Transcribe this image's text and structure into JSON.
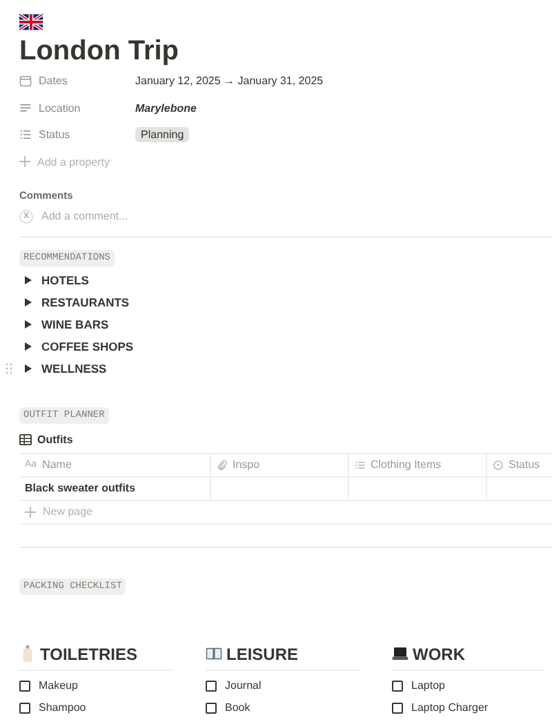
{
  "page": {
    "title": "London Trip"
  },
  "properties": [
    {
      "kind": "date",
      "label": "Dates",
      "value": "January 12, 2025 → January 31, 2025"
    },
    {
      "kind": "text",
      "label": "Location",
      "value": "Marylebone"
    },
    {
      "kind": "status",
      "label": "Status",
      "value": "Planning"
    }
  ],
  "add_property": "Add a property",
  "comments": {
    "heading": "Comments",
    "avatar": "X",
    "placeholder": "Add a comment..."
  },
  "recommendations": {
    "tag": "RECOMMENDATIONS",
    "toggles": [
      {
        "label": "HOTELS",
        "expanded": false,
        "hovered": false
      },
      {
        "label": "RESTAURANTS",
        "expanded": false,
        "hovered": false
      },
      {
        "label": "WINE BARS",
        "expanded": false,
        "hovered": false
      },
      {
        "label": "COFFEE SHOPS",
        "expanded": false,
        "hovered": false
      },
      {
        "label": "WELLNESS",
        "expanded": false,
        "hovered": true
      }
    ]
  },
  "outfit_planner": {
    "tag": "OUTFIT PLANNER",
    "view": "Outfits",
    "table": {
      "columns": [
        {
          "kind": "title",
          "icon_text": "Aa",
          "label": "Name"
        },
        {
          "kind": "files",
          "label": "Inspo"
        },
        {
          "kind": "multi",
          "label": "Clothing Items"
        },
        {
          "kind": "status",
          "label": "Status"
        }
      ],
      "rows": [
        [
          "Black sweater outfits",
          "",
          "",
          ""
        ]
      ],
      "new_row": "New page"
    }
  },
  "packing": {
    "tag": "PACKING CHECKLIST",
    "columns": [
      {
        "kind": "toiletries",
        "heading": "TOILETRIES",
        "items": [
          {
            "label": "Makeup",
            "checked": false
          },
          {
            "label": "Shampoo",
            "checked": false
          }
        ]
      },
      {
        "kind": "leisure",
        "heading": "LEISURE",
        "items": [
          {
            "label": "Journal",
            "checked": false
          },
          {
            "label": "Book",
            "checked": false
          }
        ]
      },
      {
        "kind": "work",
        "heading": "WORK",
        "items": [
          {
            "label": "Laptop",
            "checked": false
          },
          {
            "label": "Laptop Charger",
            "checked": false
          }
        ]
      }
    ]
  }
}
